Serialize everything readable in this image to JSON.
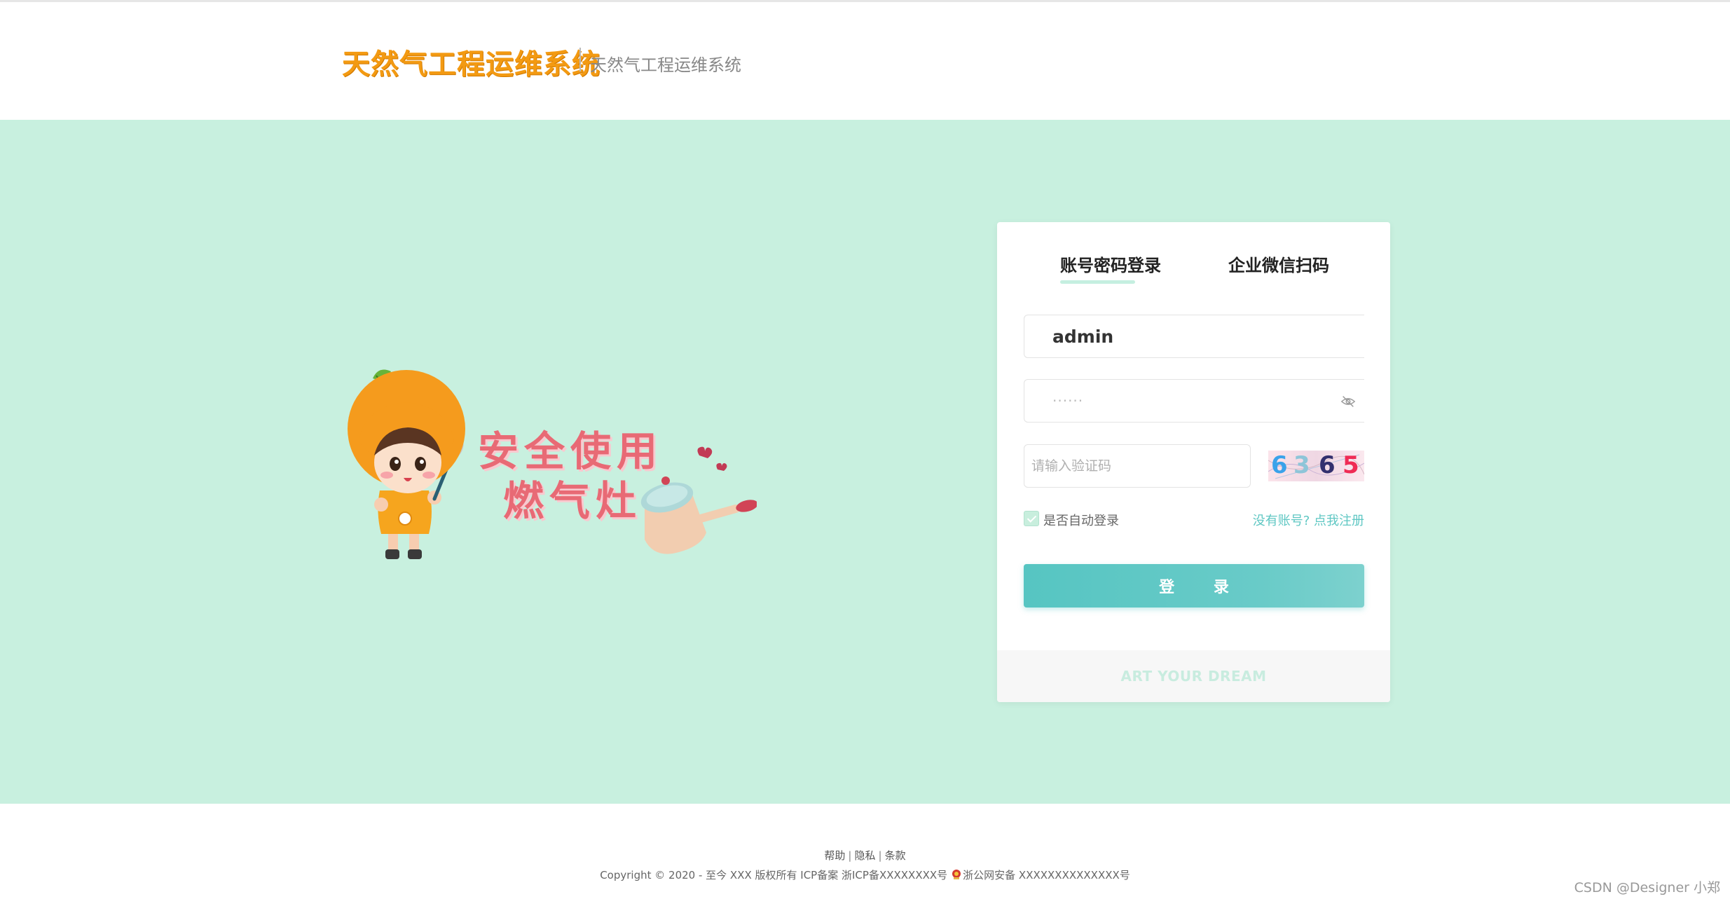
{
  "header": {
    "logo_text": "天然气工程运维系统",
    "subtitle": "天然气工程运维系统"
  },
  "illustration": {
    "slogan_line1": "安全使用",
    "slogan_line2": "燃气灶"
  },
  "login": {
    "tabs": [
      {
        "label": "账号密码登录",
        "active": true
      },
      {
        "label": "企业微信扫码",
        "active": false
      }
    ],
    "username": {
      "value": "admin"
    },
    "password": {
      "value": "······"
    },
    "captcha_input": {
      "placeholder": "请输入验证码"
    },
    "captcha_chars": [
      "6",
      "3",
      "6",
      "5"
    ],
    "auto_login_label": "是否自动登录",
    "auto_login_checked": true,
    "register_link": "没有账号? 点我注册",
    "submit_label": "登 录",
    "card_footer": "ART YOUR DREAM"
  },
  "footer": {
    "links": [
      "帮助",
      "隐私",
      "条款"
    ],
    "copyright_left": "Copyright © 2020 - 至今 XXX 版权所有 ICP备案 浙ICP备XXXXXXXX号",
    "copyright_right": "浙公网安备 XXXXXXXXXXXXXX号"
  },
  "watermark": "CSDN @Designer 小郑",
  "colors": {
    "band_bg": "#c8f0df",
    "accent": "#56c5c2",
    "logo_orange": "#f39a12",
    "slogan_pink": "#e86a75"
  },
  "icons": {
    "password_toggle": "eye-off-icon",
    "police_badge": "police-badge-icon"
  }
}
